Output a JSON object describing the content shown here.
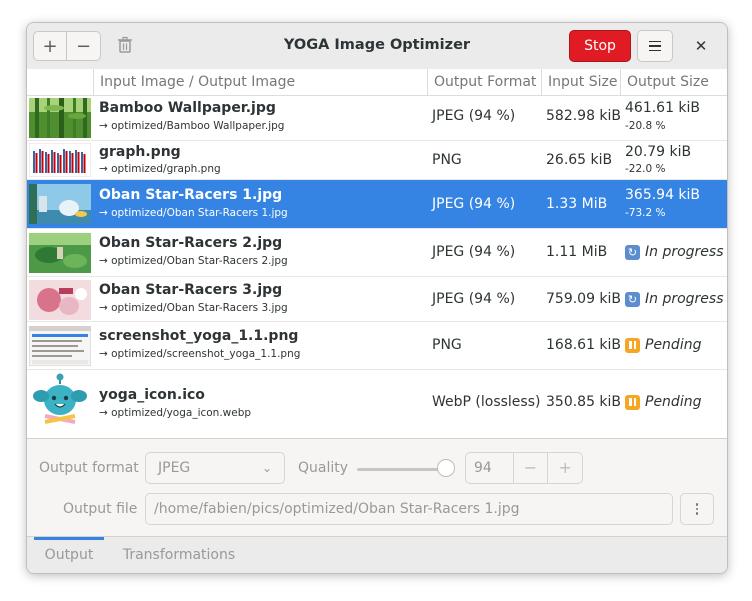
{
  "window": {
    "title": "YOGA Image Optimizer",
    "stop_label": "Stop",
    "add_symbol": "+",
    "remove_symbol": "−",
    "close_symbol": "✕"
  },
  "table": {
    "columns": [
      "Input Image / Output Image",
      "Output Format",
      "Input Size",
      "Output Size"
    ],
    "rows": [
      {
        "name": "Bamboo Wallpaper.jpg",
        "output": "→ optimized/Bamboo Wallpaper.jpg",
        "format": "JPEG (94 %)",
        "input_size": "582.98 kiB",
        "output_size": "461.61 kiB",
        "ratio": "-20.8 %",
        "status": ""
      },
      {
        "name": "graph.png",
        "output": "→ optimized/graph.png",
        "format": "PNG",
        "input_size": "26.65 kiB",
        "output_size": "20.79 kiB",
        "ratio": "-22.0 %",
        "status": ""
      },
      {
        "name": "Oban Star-Racers 1.jpg",
        "output": "→ optimized/Oban Star-Racers 1.jpg",
        "format": "JPEG (94 %)",
        "input_size": "1.33 MiB",
        "output_size": "365.94 kiB",
        "ratio": "-73.2 %",
        "status": "",
        "selected": true
      },
      {
        "name": "Oban Star-Racers 2.jpg",
        "output": "→ optimized/Oban Star-Racers 2.jpg",
        "format": "JPEG (94 %)",
        "input_size": "1.11 MiB",
        "output_size": "",
        "ratio": "",
        "status": "In progress"
      },
      {
        "name": "Oban Star-Racers 3.jpg",
        "output": "→ optimized/Oban Star-Racers 3.jpg",
        "format": "JPEG (94 %)",
        "input_size": "759.09 kiB",
        "output_size": "",
        "ratio": "",
        "status": "In progress"
      },
      {
        "name": "screenshot_yoga_1.1.png",
        "output": "→ optimized/screenshot_yoga_1.1.png",
        "format": "PNG",
        "input_size": "168.61 kiB",
        "output_size": "",
        "ratio": "",
        "status": "Pending"
      },
      {
        "name": "yoga_icon.ico",
        "output": "→ optimized/yoga_icon.webp",
        "format": "WebP (lossless)",
        "input_size": "350.85 kiB",
        "output_size": "",
        "ratio": "",
        "status": "Pending"
      }
    ]
  },
  "settings": {
    "output_format_label": "Output format",
    "output_format_value": "JPEG",
    "quality_label": "Quality",
    "quality_value": "94",
    "quality_level": 0.94,
    "spin_minus": "−",
    "spin_plus": "+",
    "output_file_label": "Output file",
    "output_file_value": "/home/fabien/pics/optimized/Oban Star-Racers 1.jpg"
  },
  "tabs": [
    {
      "label": "Output",
      "active": true
    },
    {
      "label": "Transformations",
      "active": false
    }
  ],
  "colors": {
    "accent": "#3584e4",
    "stop": "#e01b24",
    "in_progress_icon": "#5c8dcf",
    "pending_icon": "#f5a623"
  },
  "icons": {
    "in_progress": "sync-icon",
    "pending": "pause-icon"
  }
}
